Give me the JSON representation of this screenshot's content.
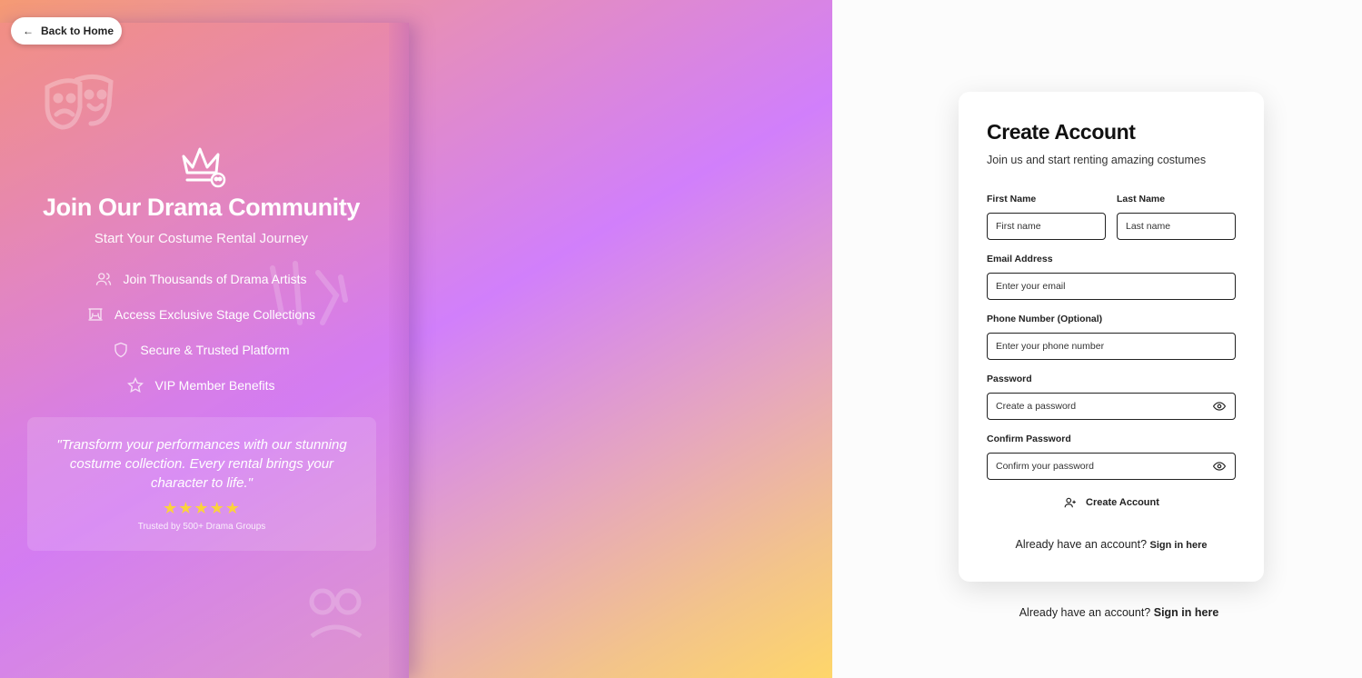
{
  "nav": {
    "back_label": "Back to Home"
  },
  "hero": {
    "title": "Join Our Drama Community",
    "subtitle": "Start Your Costume Rental Journey",
    "features": [
      {
        "icon": "users-icon",
        "label": "Join Thousands of Drama Artists"
      },
      {
        "icon": "theater-icon",
        "label": "Access Exclusive Stage Collections"
      },
      {
        "icon": "shield-icon",
        "label": "Secure & Trusted Platform"
      },
      {
        "icon": "star-icon",
        "label": "VIP Member Benefits"
      }
    ],
    "quote": "\"Transform your performances with our stunning costume collection. Every rental brings your character to life.\"",
    "stars": "★★★★★",
    "trusted": "Trusted by 500+ Drama Groups"
  },
  "form": {
    "title": "Create Account",
    "subtitle": "Join us and start renting amazing costumes",
    "first_name": {
      "label": "First Name",
      "placeholder": "First name"
    },
    "last_name": {
      "label": "Last Name",
      "placeholder": "Last name"
    },
    "email": {
      "label": "Email Address",
      "placeholder": "Enter your email"
    },
    "phone": {
      "label": "Phone Number (Optional)",
      "placeholder": "Enter your phone number"
    },
    "password": {
      "label": "Password",
      "placeholder": "Create a password"
    },
    "confirm_password": {
      "label": "Confirm Password",
      "placeholder": "Confirm your password"
    },
    "submit_label": "Create Account",
    "signin_prompt": "Already have an account?",
    "signin_link": "Sign in here"
  },
  "footer": {
    "signin_prompt": "Already have an account?",
    "signin_link": "Sign in here"
  },
  "colors": {
    "star": "#fbd23c",
    "gradient_start": "#f59a74",
    "gradient_mid": "#d17ffb",
    "gradient_end": "#fed66a"
  }
}
